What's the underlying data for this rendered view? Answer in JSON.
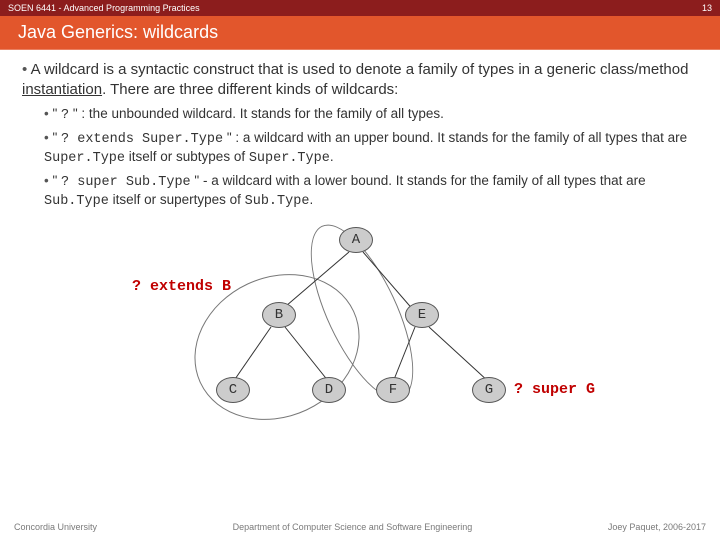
{
  "header": {
    "course": "SOEN 6441 - Advanced Programming Practices",
    "slide_no": "13",
    "title": "Java Generics: wildcards"
  },
  "bullets": {
    "intro_a": "A wildcard is a syntactic construct that is used to denote a family of types in a generic class/method ",
    "intro_u": "instantiation",
    "intro_b": ". There are three different kinds of wildcards:",
    "sub1_a": "\" ",
    "sub1_code": "?",
    "sub1_b": " \" : the unbounded wildcard. It stands for the family of all types.",
    "sub2_a": "\" ",
    "sub2_code": "? extends Super.Type",
    "sub2_b": " \" : a wildcard with an upper bound. It stands for the family of all types that are ",
    "sub2_c": "Super.Type",
    "sub2_d": " itself or subtypes of ",
    "sub2_e": "Super.Type",
    "sub2_f": ".",
    "sub3_a": "\" ",
    "sub3_code": "? super Sub.Type",
    "sub3_b": " \" - a wildcard with a lower bound. It stands for the family of all types that are ",
    "sub3_c": "Sub.Type",
    "sub3_d": " itself or supertypes of ",
    "sub3_e": "Sub.Type",
    "sub3_f": "."
  },
  "diagram": {
    "label_left": "? extends B",
    "label_right": "? super G",
    "nodes": {
      "A": "A",
      "B": "B",
      "C": "C",
      "D": "D",
      "E": "E",
      "F": "F",
      "G": "G"
    }
  },
  "footer": {
    "left": "Concordia University",
    "mid": "Department of Computer Science and Software Engineering",
    "right": "Joey Paquet, 2006-2017"
  }
}
